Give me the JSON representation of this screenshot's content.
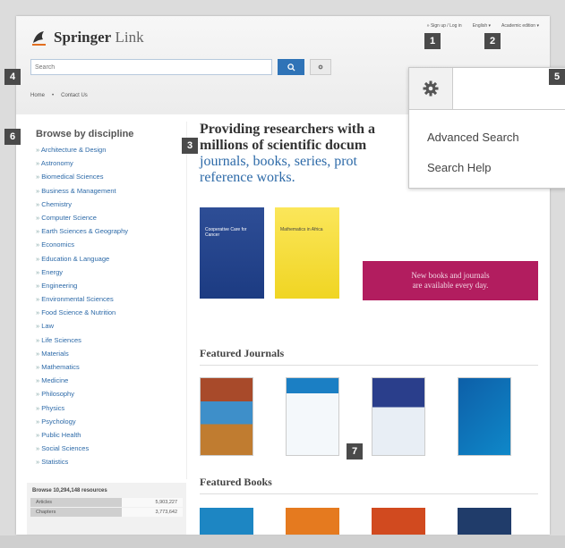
{
  "brand": {
    "name_bold": "Springer",
    "name_light": "Link"
  },
  "top_links": [
    "» Sign up / Log in",
    "English ▾",
    "Academic edition ▾"
  ],
  "search": {
    "placeholder": "Search"
  },
  "breadcrumb": [
    "Home",
    "Contact Us"
  ],
  "sidebar": {
    "title": "Browse by discipline",
    "items": [
      "Architecture & Design",
      "Astronomy",
      "Biomedical Sciences",
      "Business & Management",
      "Chemistry",
      "Computer Science",
      "Earth Sciences & Geography",
      "Economics",
      "Education & Language",
      "Energy",
      "Engineering",
      "Environmental Sciences",
      "Food Science & Nutrition",
      "Law",
      "Life Sciences",
      "Materials",
      "Mathematics",
      "Medicine",
      "Philosophy",
      "Physics",
      "Psychology",
      "Public Health",
      "Social Sciences",
      "Statistics"
    ]
  },
  "stats": {
    "title": "Browse 10,294,148 resources",
    "rows": [
      {
        "label": "Articles",
        "value": "5,903,227"
      },
      {
        "label": "Chapters",
        "value": "3,773,642"
      }
    ]
  },
  "main": {
    "headline_1": "Providing researchers with a",
    "headline_2": "millions of scientific docum",
    "headline_3_links": [
      "journals",
      "books",
      "series",
      "prot"
    ],
    "headline_4": "reference works.",
    "banner_1": "New books and journals",
    "banner_2": "are available every day.",
    "featured_journals": "Featured Journals",
    "featured_books": "Featured Books",
    "book1_title": "Cooperative Care for Cancer",
    "book2_title": "Mathematics in Africa"
  },
  "dropdown": {
    "items": [
      "Advanced Search",
      "Search Help"
    ]
  },
  "callouts": [
    "1",
    "2",
    "3",
    "4",
    "5",
    "6",
    "7"
  ],
  "colors": {
    "accent": "#2f73b7",
    "banner": "#b21d5f",
    "link": "#2d6aa8",
    "callout": "#4a4a4a"
  }
}
